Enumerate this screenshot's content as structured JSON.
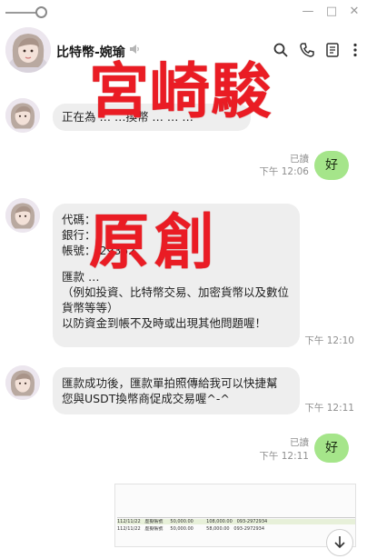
{
  "window": {
    "minimize_label": "—",
    "maximize_label": "□",
    "close_label": "✕"
  },
  "header": {
    "chat_name": "比特幣-婉瑜",
    "icons": [
      "search-icon",
      "phone-icon",
      "notes-icon",
      "more-icon"
    ]
  },
  "messages": [
    {
      "type": "incoming",
      "lines": [
        "正在為 … …換幣 … … …^"
      ]
    },
    {
      "type": "outgoing",
      "text": "好",
      "read": "已讀",
      "time": "下午 12:06"
    },
    {
      "type": "incoming",
      "lines": [
        "代碼：",
        "銀行：",
        "帳號：        29352",
        "",
        "匯款 …",
        "（例如投資、比特幣交易、加密貨幣以及數位",
        "貨幣等等）",
        "以防資金到帳不及時或出現其他問題喔！"
      ],
      "time": "下午 12:10"
    },
    {
      "type": "incoming",
      "lines": [
        "匯款成功後，匯款單拍照傳給我可以快捷幫",
        "您與USDT換幣商促成交易喔^-^"
      ],
      "time": "下午 12:11"
    },
    {
      "type": "outgoing",
      "text": "好",
      "read": "已讀",
      "time": "下午 12:11"
    }
  ],
  "watermark": {
    "line1": "宮崎駿",
    "line2": "原創",
    "color": "#ea1c24"
  },
  "attachment": {
    "rows": [
      [
        "112/11/22",
        "虛擬帳號",
        "50,000.00",
        "",
        "108,000.00",
        "093-2972934"
      ],
      [
        "112/11/22",
        "虛擬帳號",
        "50,000.00",
        "",
        "58,000.00",
        "093-2972934"
      ]
    ]
  },
  "colors": {
    "outgoing_bubble": "#a5e58a",
    "incoming_bubble": "#eeeeee",
    "meta_text": "#8f8f8f"
  }
}
